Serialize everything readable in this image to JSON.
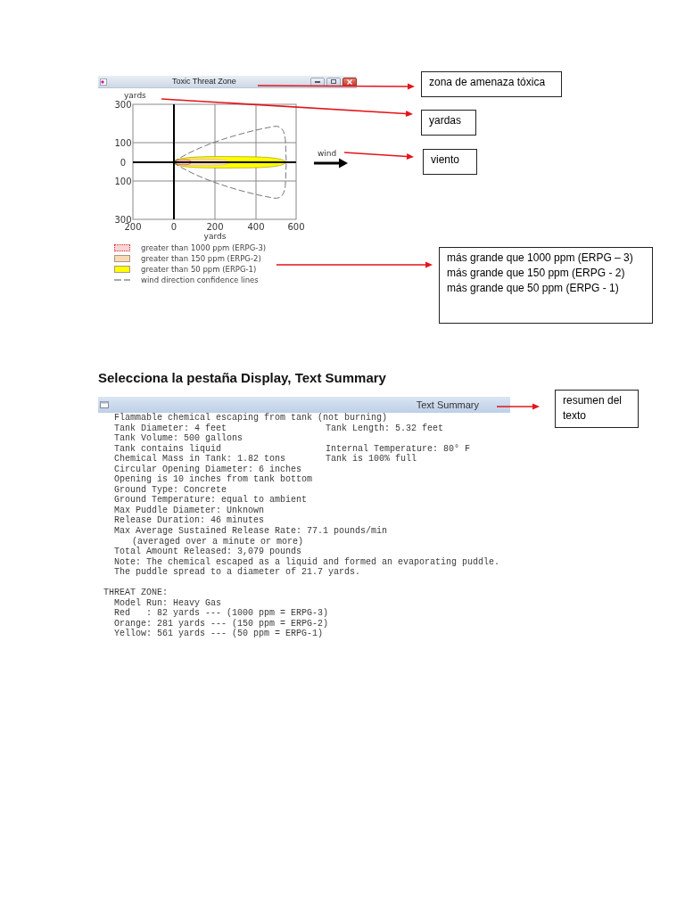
{
  "threat_zone_window": {
    "title": "Toxic Threat Zone",
    "y_axis": {
      "title": "yards",
      "ticks": [
        "300",
        "100",
        "0",
        "100",
        "300"
      ]
    },
    "x_axis": {
      "title": "yards",
      "ticks": [
        "200",
        "0",
        "200",
        "400",
        "600"
      ]
    },
    "wind_label": "wind",
    "legend": [
      {
        "label": "greater than 1000 ppm (ERPG-3)",
        "kind": "area",
        "color": "#f9d4d4"
      },
      {
        "label": "greater than 150 ppm (ERPG-2)",
        "kind": "area",
        "color": "#f7dab3"
      },
      {
        "label": "greater than 50 ppm (ERPG-1)",
        "kind": "area",
        "color": "#ffff00"
      },
      {
        "label": "wind direction confidence lines",
        "kind": "dashed-line"
      }
    ]
  },
  "threat_zone_notes": [
    {
      "lines": [
        "zona de amenaza tóxica"
      ]
    },
    {
      "lines": [
        "yardas"
      ]
    },
    {
      "lines": [
        "viento"
      ]
    },
    {
      "lines": [
        "más grande que 1000 ppm (ERPG – 3)",
        "más grande que 150 ppm (ERPG - 2)",
        "más grande que 50 ppm (ERPG - 1)"
      ]
    }
  ],
  "instruction": "Selecciona la pestaña Display, Text Summary",
  "text_summary_window": {
    "title": "Text Summary",
    "lines": [
      {
        "kind": "entry",
        "text": "Flammable chemical escaping from tank (not burning)"
      },
      {
        "kind": "entry",
        "text": "Tank Diameter: 4 feet",
        "column_2": "Tank Length: 5.32 feet"
      },
      {
        "kind": "entry",
        "text": "Tank Volume: 500 gallons"
      },
      {
        "kind": "entry",
        "text": "Tank contains liquid",
        "column_2": "Internal Temperature: 80° F"
      },
      {
        "kind": "entry",
        "text": "Chemical Mass in Tank: 1.82 tons",
        "column_2": "Tank is 100% full"
      },
      {
        "kind": "entry",
        "text": "Circular Opening Diameter: 6 inches"
      },
      {
        "kind": "entry",
        "text": "Opening is 10 inches from tank bottom"
      },
      {
        "kind": "entry",
        "text": "Ground Type: Concrete"
      },
      {
        "kind": "entry",
        "text": "Ground Temperature: equal to ambient"
      },
      {
        "kind": "entry",
        "text": "Max Puddle Diameter: Unknown"
      },
      {
        "kind": "entry",
        "text": "Release Duration: 46 minutes"
      },
      {
        "kind": "entry",
        "text": "Max Average Sustained Release Rate: 77.1 pounds/min"
      },
      {
        "kind": "continuation",
        "text": "(averaged over a minute or more)"
      },
      {
        "kind": "entry",
        "text": "Total Amount Released: 3,079 pounds"
      },
      {
        "kind": "entry",
        "text": "Note: The chemical escaped as a liquid and formed an evaporating puddle."
      },
      {
        "kind": "entry",
        "text": "The puddle spread to a diameter of 21.7 yards."
      }
    ],
    "threat_zone": {
      "heading": "THREAT ZONE:",
      "lines": [
        "Model Run: Heavy Gas",
        "Red   : 82 yards --- (1000 ppm = ERPG-3)",
        "Orange: 281 yards --- (150 ppm = ERPG-2)",
        "Yellow: 561 yards --- (50 ppm = ERPG-1)"
      ]
    }
  },
  "text_summary_note": {
    "lines": [
      "resumen del texto"
    ]
  }
}
